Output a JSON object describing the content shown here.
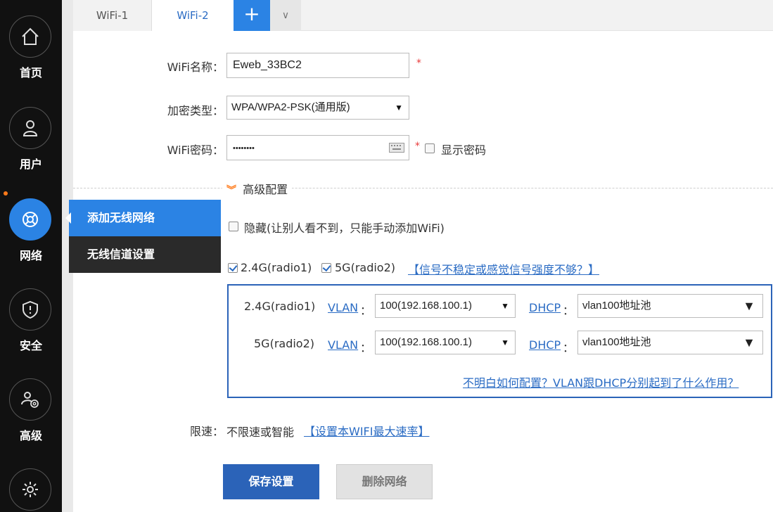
{
  "sidebar": {
    "items": [
      {
        "label": "首页",
        "icon": "home-icon"
      },
      {
        "label": "用户",
        "icon": "user-icon"
      },
      {
        "label": "网络",
        "icon": "network-icon",
        "active": true
      },
      {
        "label": "安全",
        "icon": "shield-icon"
      },
      {
        "label": "高级",
        "icon": "advanced-users-icon"
      },
      {
        "label": "",
        "icon": "gear-icon"
      }
    ]
  },
  "submenu": {
    "items": [
      {
        "label": "添加无线网络",
        "active": true
      },
      {
        "label": "无线信道设置",
        "active": false
      }
    ]
  },
  "tabs": {
    "items": [
      {
        "label": "WiFi-1"
      },
      {
        "label": "WiFi-2",
        "active": true
      }
    ],
    "add_label": "+",
    "more_label": "∨"
  },
  "form": {
    "ssid_label": "WiFi名称：",
    "ssid_value": "Eweb_33BC2",
    "encryption_label": "加密类型：",
    "encryption_value": "WPA/WPA2-PSK(通用版)",
    "password_label": "WiFi密码：",
    "password_value": "••••••••",
    "required_mark": "*",
    "show_password_label": "显示密码",
    "advanced_label": "高级配置",
    "hidden_label": "隐藏(让别人看不到，只能手动添加WiFi)",
    "radio1_label": "2.4G(radio1)",
    "radio2_label": "5G(radio2)",
    "signal_help_link": "【信号不稳定或感觉信号强度不够？】",
    "radios": [
      {
        "name": "2.4G(radio1)",
        "vlan_label": "VLAN",
        "vlan_value": "100(192.168.100.1)",
        "dhcp_label": "DHCP",
        "dhcp_value": "vlan100地址池"
      },
      {
        "name": "5G(radio2)",
        "vlan_label": "VLAN",
        "vlan_value": "100(192.168.100.1)",
        "dhcp_label": "DHCP",
        "dhcp_value": "vlan100地址池"
      }
    ],
    "colon": "：",
    "vlan_help_link": "不明白如何配置？VLAN跟DHCP分别起到了什么作用？",
    "rate_label": "限速：",
    "rate_value": "不限速或智能",
    "rate_link": "【设置本WIFI最大速率】",
    "save_label": "保存设置",
    "delete_label": "删除网络"
  },
  "colors": {
    "sidebar_bg": "#111111",
    "accent_blue": "#2b83e4",
    "button_blue": "#2b63b8",
    "link_blue": "#2b6cc4",
    "required_red": "#e83a3a",
    "indicator_orange": "#ff7a1a"
  }
}
